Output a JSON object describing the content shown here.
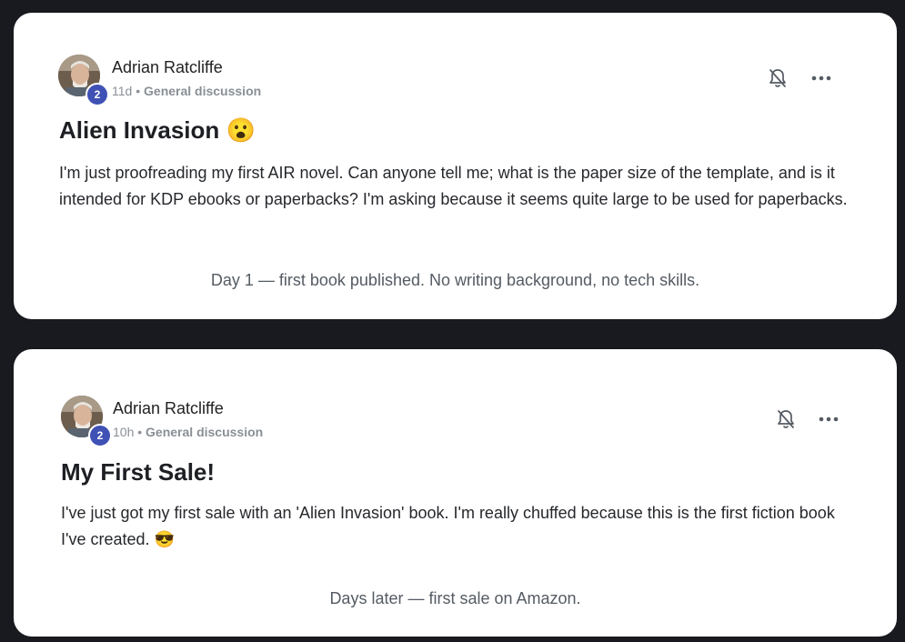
{
  "posts": [
    {
      "author": "Adrian Ratcliffe",
      "badge": "2",
      "time": "11d",
      "separator": "•",
      "category": "General discussion",
      "title": "Alien Invasion",
      "title_emoji": "😮",
      "body": "I'm just proofreading my first AIR novel. Can anyone tell me; what is the paper size of the template, and is it intended for KDP ebooks or paperbacks? I'm asking because it seems quite large to be used for paperbacks.",
      "caption": "Day 1 — first book published. No writing background, no tech skills.",
      "more_label": "•••"
    },
    {
      "author": "Adrian Ratcliffe",
      "badge": "2",
      "time": "10h",
      "separator": "•",
      "category": "General discussion",
      "title": "My First Sale!",
      "body": "I've just got my first sale with an 'Alien Invasion' book. I'm really chuffed because this is the first fiction book I've created.",
      "body_emoji": "😎",
      "caption": "Days later — first sale on Amazon.",
      "more_label": "•••"
    }
  ],
  "icons": {
    "notify": "bell-off-icon",
    "more": "more-horizontal-icon"
  },
  "colors": {
    "background": "#181a1f",
    "card": "#ffffff",
    "badge": "#3f51b5",
    "meta": "#8a8f96"
  }
}
